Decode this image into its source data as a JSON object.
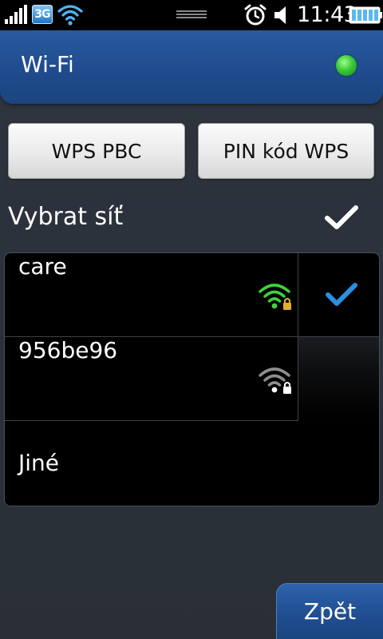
{
  "status_bar": {
    "network_badge": "3G",
    "time": "11:43",
    "icons": [
      "signal-icon",
      "3g-icon",
      "wifi-icon",
      "handle-icon",
      "alarm-icon",
      "sound-icon",
      "battery-icon"
    ]
  },
  "header": {
    "title": "Wi-Fi",
    "status_color": "#3cc83a"
  },
  "buttons": {
    "wps_pbc": "WPS PBC",
    "pin_wps": "PIN kód WPS"
  },
  "section": {
    "title": "Vybrat síť"
  },
  "networks": [
    {
      "name": "care",
      "signal_color": "#3fd23a",
      "secured": true,
      "selected": true
    },
    {
      "name": "956be96",
      "signal_color": "#9a9a9a",
      "secured": true,
      "selected": false
    },
    {
      "name": "Jiné"
    }
  ],
  "back_button": "Zpět",
  "colors": {
    "accent_blue": "#1f4c8e",
    "check_blue": "#2a8fe0"
  }
}
